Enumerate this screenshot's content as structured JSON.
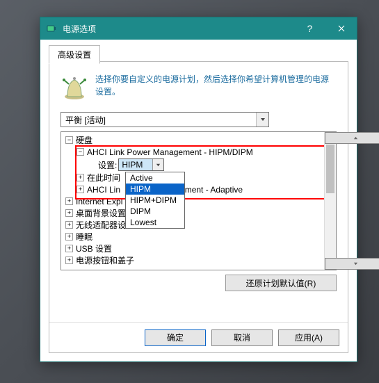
{
  "titlebar": {
    "title": "电源选项",
    "help_tooltip": "帮助",
    "close_tooltip": "关闭"
  },
  "tabs": {
    "advanced": "高级设置"
  },
  "intro": "选择你要自定义的电源计划，然后选择你希望计算机管理的电源设置。",
  "plan_combo": {
    "selected": "平衡 [活动]"
  },
  "tree": {
    "hard_disk": "硬盘",
    "ahci_hipm_dipm": "AHCI Link Power Management - HIPM/DIPM",
    "setting_label": "设置:",
    "setting_value": "HIPM",
    "idle_time_label": "在此时间",
    "ahci_adaptive": "AHCI Link Power Management - Adaptive",
    "ahci_adaptive_vis1": "AHCI Lin",
    "ahci_adaptive_vis2": "ement - Adaptive",
    "ie": "Internet Expl",
    "desktop_bg": "桌面背景设置",
    "wireless": "无线适配器设置",
    "sleep": "睡眠",
    "usb": "USB 设置",
    "power_button": "电源按钮和盖子"
  },
  "dropdown": {
    "options": [
      "Active",
      "HIPM",
      "HIPM+DIPM",
      "DIPM",
      "Lowest"
    ],
    "selected_index": 1
  },
  "buttons": {
    "restore": "还原计划默认值(R)",
    "ok": "确定",
    "cancel": "取消",
    "apply": "应用(A)"
  }
}
